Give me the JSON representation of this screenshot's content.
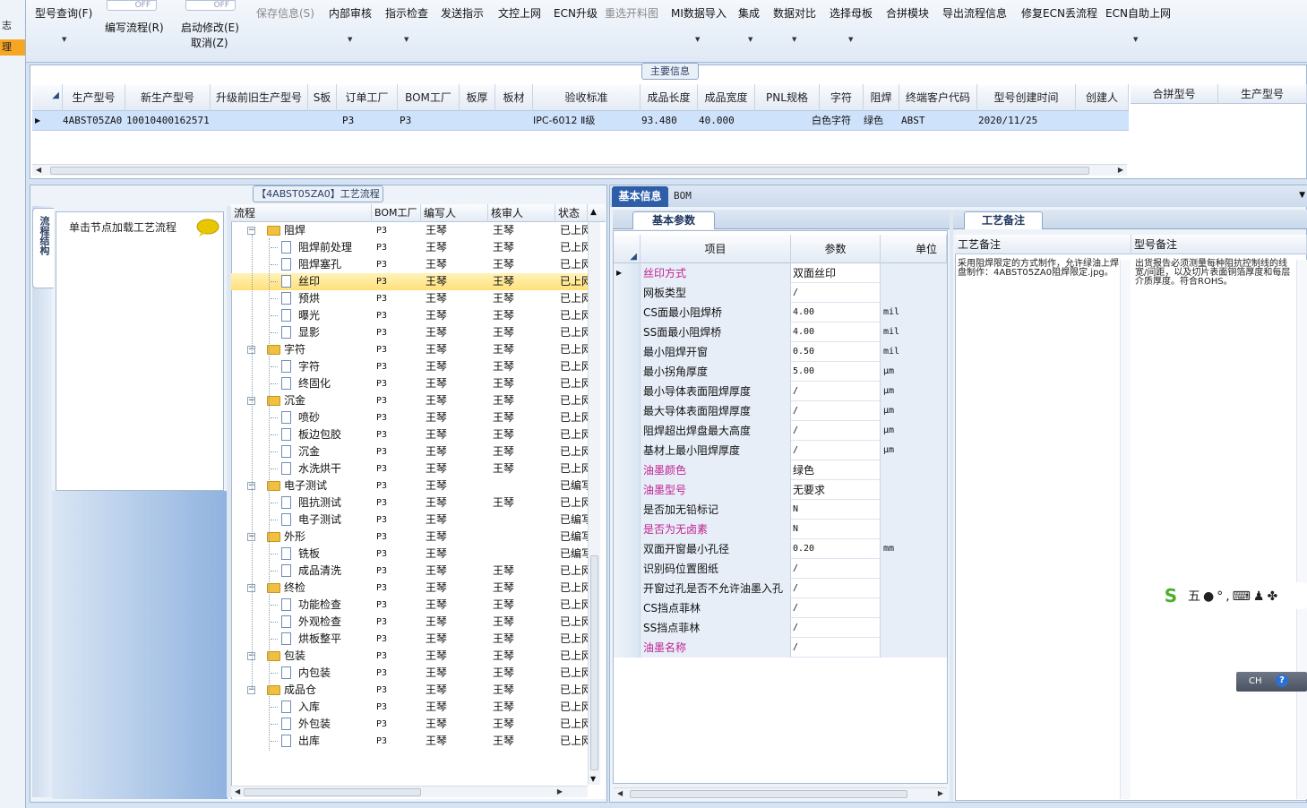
{
  "left_strip": {
    "items": [
      "志",
      "理"
    ]
  },
  "toolbar": {
    "buttons": [
      {
        "label": "型号查询(F)"
      },
      {
        "label": "编写流程(R)"
      },
      {
        "label": "启动修改(E)"
      },
      {
        "label": "取消(Z)"
      },
      {
        "label": "保存信息(S)"
      },
      {
        "label": "内部审核"
      },
      {
        "label": "指示检查"
      },
      {
        "label": "发送指示"
      },
      {
        "label": "文控上网"
      },
      {
        "label": "ECN升级"
      },
      {
        "label": "重选开料图"
      },
      {
        "label": "MI数据导入"
      },
      {
        "label": "集成"
      },
      {
        "label": "数据对比"
      },
      {
        "label": "选择母板"
      },
      {
        "label": "合拼模块"
      },
      {
        "label": "导出流程信息"
      },
      {
        "label": "修复ECN丢流程"
      },
      {
        "label": "ECN自助上网"
      }
    ],
    "toggle_off": "OFF"
  },
  "main_info": {
    "tab_label": "主要信息",
    "columns": [
      "生产型号",
      "新生产型号",
      "升级前旧生产型号",
      "S板",
      "订单工厂",
      "BOM工厂",
      "板厚",
      "板材",
      "验收标准",
      "成品长度",
      "成品宽度",
      "PNL规格",
      "字符",
      "阻焊",
      "终端客户代码",
      "型号创建时间",
      "创建人"
    ],
    "row": [
      "4ABST05ZA0",
      "10010400162571",
      "",
      "",
      "P3",
      "P3",
      "",
      "",
      "IPC-6012 Ⅱ级",
      "93.480",
      "40.000",
      "",
      "白色字符",
      "绿色",
      "ABST",
      "2020/11/25",
      ""
    ],
    "right_columns": [
      "合拼型号",
      "生产型号"
    ]
  },
  "flow_panel": {
    "tab_label": "【4ABST05ZA0】工艺流程",
    "nav_tab": "流程结构",
    "hint": "单击节点加载工艺流程",
    "columns": [
      "流程",
      "BOM工厂",
      "编写人",
      "核审人",
      "状态"
    ],
    "rows": [
      {
        "name": "阻焊",
        "type": "folder",
        "bom": "P3",
        "writer": "王琴",
        "reviewer": "王琴",
        "status": "已上网"
      },
      {
        "name": "阻焊前处理",
        "type": "doc",
        "bom": "P3",
        "writer": "王琴",
        "reviewer": "王琴",
        "status": "已上网"
      },
      {
        "name": "阻焊塞孔",
        "type": "doc",
        "bom": "P3",
        "writer": "王琴",
        "reviewer": "王琴",
        "status": "已上网"
      },
      {
        "name": "丝印",
        "type": "doc",
        "bom": "P3",
        "writer": "王琴",
        "reviewer": "王琴",
        "status": "已上网",
        "selected": true
      },
      {
        "name": "预烘",
        "type": "doc",
        "bom": "P3",
        "writer": "王琴",
        "reviewer": "王琴",
        "status": "已上网"
      },
      {
        "name": "曝光",
        "type": "doc",
        "bom": "P3",
        "writer": "王琴",
        "reviewer": "王琴",
        "status": "已上网"
      },
      {
        "name": "显影",
        "type": "doc",
        "bom": "P3",
        "writer": "王琴",
        "reviewer": "王琴",
        "status": "已上网"
      },
      {
        "name": "字符",
        "type": "folder",
        "bom": "P3",
        "writer": "王琴",
        "reviewer": "王琴",
        "status": "已上网"
      },
      {
        "name": "字符",
        "type": "doc",
        "bom": "P3",
        "writer": "王琴",
        "reviewer": "王琴",
        "status": "已上网"
      },
      {
        "name": "终固化",
        "type": "doc",
        "bom": "P3",
        "writer": "王琴",
        "reviewer": "王琴",
        "status": "已上网"
      },
      {
        "name": "沉金",
        "type": "folder",
        "bom": "P3",
        "writer": "王琴",
        "reviewer": "王琴",
        "status": "已上网"
      },
      {
        "name": "喷砂",
        "type": "doc",
        "bom": "P3",
        "writer": "王琴",
        "reviewer": "王琴",
        "status": "已上网"
      },
      {
        "name": "板边包胶",
        "type": "doc",
        "bom": "P3",
        "writer": "王琴",
        "reviewer": "王琴",
        "status": "已上网"
      },
      {
        "name": "沉金",
        "type": "doc",
        "bom": "P3",
        "writer": "王琴",
        "reviewer": "王琴",
        "status": "已上网"
      },
      {
        "name": "水洗烘干",
        "type": "doc",
        "bom": "P3",
        "writer": "王琴",
        "reviewer": "王琴",
        "status": "已上网"
      },
      {
        "name": "电子测试",
        "type": "folder",
        "bom": "P3",
        "writer": "王琴",
        "reviewer": "",
        "status": "已编写"
      },
      {
        "name": "阻抗测试",
        "type": "doc",
        "bom": "P3",
        "writer": "王琴",
        "reviewer": "王琴",
        "status": "已上网"
      },
      {
        "name": "电子测试",
        "type": "doc",
        "bom": "P3",
        "writer": "王琴",
        "reviewer": "",
        "status": "已编写"
      },
      {
        "name": "外形",
        "type": "folder",
        "bom": "P3",
        "writer": "王琴",
        "reviewer": "",
        "status": "已编写"
      },
      {
        "name": "铣板",
        "type": "doc",
        "bom": "P3",
        "writer": "王琴",
        "reviewer": "",
        "status": "已编写"
      },
      {
        "name": "成品清洗",
        "type": "doc",
        "bom": "P3",
        "writer": "王琴",
        "reviewer": "王琴",
        "status": "已上网"
      },
      {
        "name": "终检",
        "type": "folder",
        "bom": "P3",
        "writer": "王琴",
        "reviewer": "王琴",
        "status": "已上网"
      },
      {
        "name": "功能检查",
        "type": "doc",
        "bom": "P3",
        "writer": "王琴",
        "reviewer": "王琴",
        "status": "已上网"
      },
      {
        "name": "外观检查",
        "type": "doc",
        "bom": "P3",
        "writer": "王琴",
        "reviewer": "王琴",
        "status": "已上网"
      },
      {
        "name": "烘板整平",
        "type": "doc",
        "bom": "P3",
        "writer": "王琴",
        "reviewer": "王琴",
        "status": "已上网"
      },
      {
        "name": "包装",
        "type": "folder",
        "bom": "P3",
        "writer": "王琴",
        "reviewer": "王琴",
        "status": "已上网"
      },
      {
        "name": "内包装",
        "type": "doc",
        "bom": "P3",
        "writer": "王琴",
        "reviewer": "王琴",
        "status": "已上网"
      },
      {
        "name": "成品仓",
        "type": "folder",
        "bom": "P3",
        "writer": "王琴",
        "reviewer": "王琴",
        "status": "已上网"
      },
      {
        "name": "入库",
        "type": "doc",
        "bom": "P3",
        "writer": "王琴",
        "reviewer": "王琴",
        "status": "已上网"
      },
      {
        "name": "外包装",
        "type": "doc",
        "bom": "P3",
        "writer": "王琴",
        "reviewer": "王琴",
        "status": "已上网"
      },
      {
        "name": "出库",
        "type": "doc",
        "bom": "P3",
        "writer": "王琴",
        "reviewer": "王琴",
        "status": "已上网"
      }
    ]
  },
  "right_panel": {
    "tabs": [
      "基本信息",
      "BOM"
    ],
    "basic_params": {
      "tab_label": "基本参数",
      "columns": [
        "项目",
        "参数",
        "单位"
      ],
      "rows": [
        {
          "item": "丝印方式",
          "value": "双面丝印",
          "unit": "",
          "pink": true
        },
        {
          "item": "网板类型",
          "value": "/",
          "unit": "",
          "pink": false
        },
        {
          "item": "CS面最小阻焊桥",
          "value": "4.00",
          "unit": "mil",
          "pink": false
        },
        {
          "item": "SS面最小阻焊桥",
          "value": "4.00",
          "unit": "mil",
          "pink": false
        },
        {
          "item": "最小阻焊开窗",
          "value": "0.50",
          "unit": "mil",
          "pink": false
        },
        {
          "item": "最小拐角厚度",
          "value": "5.00",
          "unit": "μm",
          "pink": false
        },
        {
          "item": "最小导体表面阻焊厚度",
          "value": "/",
          "unit": "μm",
          "pink": false
        },
        {
          "item": "最大导体表面阻焊厚度",
          "value": "/",
          "unit": "μm",
          "pink": false
        },
        {
          "item": "阻焊超出焊盘最大高度",
          "value": "/",
          "unit": "μm",
          "pink": false
        },
        {
          "item": "基材上最小阻焊厚度",
          "value": "/",
          "unit": "μm",
          "pink": false
        },
        {
          "item": "油墨颜色",
          "value": "绿色",
          "unit": "",
          "pink": true
        },
        {
          "item": "油墨型号",
          "value": "无要求",
          "unit": "",
          "pink": true
        },
        {
          "item": "是否加无铅标记",
          "value": "N",
          "unit": "",
          "pink": false
        },
        {
          "item": "是否为无卤素",
          "value": "N",
          "unit": "",
          "pink": true
        },
        {
          "item": "双面开窗最小孔径",
          "value": "0.20",
          "unit": "mm",
          "pink": false
        },
        {
          "item": "识别码位置图纸",
          "value": "/",
          "unit": "",
          "pink": false
        },
        {
          "item": "开窗过孔是否不允许油墨入孔",
          "value": "/",
          "unit": "",
          "pink": false
        },
        {
          "item": "CS挡点菲林",
          "value": "/",
          "unit": "",
          "pink": false
        },
        {
          "item": "SS挡点菲林",
          "value": "/",
          "unit": "",
          "pink": false
        },
        {
          "item": "油墨名称",
          "value": "/",
          "unit": "",
          "pink": true
        }
      ]
    },
    "process_notes": {
      "tab_label": "工艺备注",
      "columns": [
        "工艺备注",
        "型号备注"
      ],
      "process_note": "采用阻焊限定的方式制作，允许绿油上焊盘制作：4ABST05ZA0阻焊限定.jpg。",
      "model_note": "出货报告必须测量每种阻抗控制线的线宽/间距，以及切片表面铜箔厚度和每层介质厚度。符合ROHS。"
    }
  },
  "ime": {
    "logo": "S",
    "mode": "五"
  },
  "langbar": {
    "lang": "CH",
    "help": "?"
  },
  "colors": {
    "selection": "#ffe07a",
    "row_highlight": "#cfe2fb",
    "pink_label": "#c0228f",
    "tab_active": "#2e5ea8"
  }
}
